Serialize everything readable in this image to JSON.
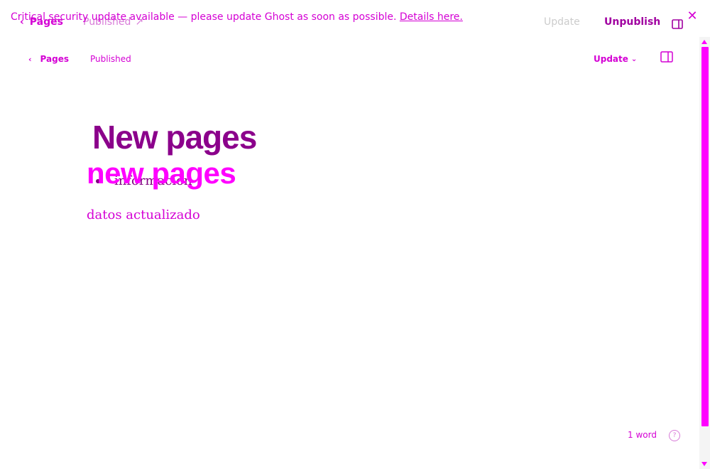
{
  "alert": {
    "message": "Critical security update available — please update Ghost as soon as possible.",
    "link": "Details here."
  },
  "top_nav": {
    "back_label": "Pages",
    "status": "Published",
    "update_label": "Update",
    "unpublish_label": "Unpublish"
  },
  "toolbar": {
    "back_label": "Pages",
    "status": "Published",
    "update_label": "Update"
  },
  "editor": {
    "title": "New pages",
    "title_overlay": "new pages",
    "bullets": [
      "información"
    ],
    "paragraph": "datos actualizado"
  },
  "footer": {
    "word_count": "1 word",
    "help": "?"
  },
  "colors": {
    "accent": "#ff00ff",
    "accent_dark": "#8b008b",
    "muted": "#cccccc"
  }
}
